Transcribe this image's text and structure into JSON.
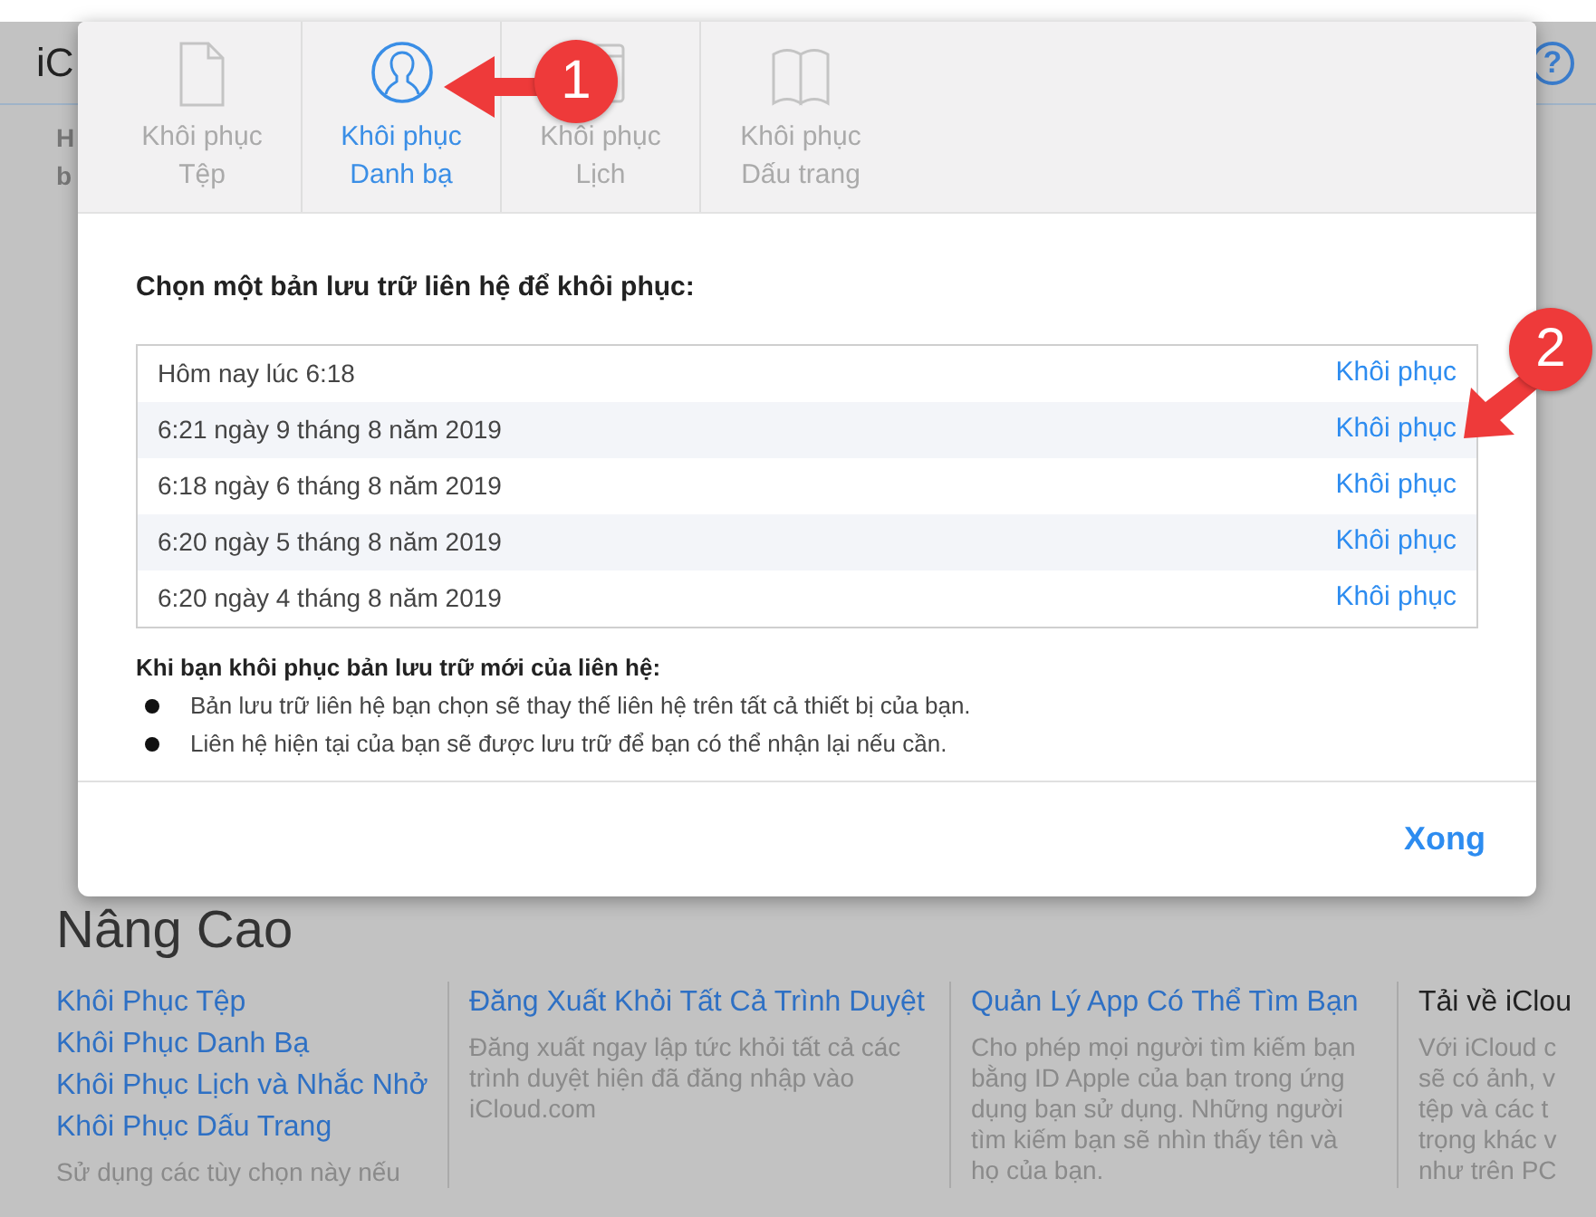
{
  "page": {
    "title": "iC",
    "help": "?",
    "left_text": [
      "H",
      "b"
    ]
  },
  "advanced": {
    "heading": "Nâng Cao",
    "columns": [
      {
        "links": [
          "Khôi Phục Tệp",
          "Khôi Phục Danh Bạ",
          "Khôi Phục Lịch và Nhắc Nhở",
          "Khôi Phục Dấu Trang"
        ],
        "description": [
          "Sử dụng các tùy chọn này nếu"
        ],
        "kind": "links"
      },
      {
        "links": [
          "Đăng Xuất Khỏi Tất Cả Trình Duyệt"
        ],
        "description": [
          "Đăng xuất ngay lập tức khỏi tất cả các",
          "trình duyệt hiện đã đăng nhập vào",
          "iCloud.com"
        ],
        "kind": "links"
      },
      {
        "links": [
          "Quản Lý App Có Thể Tìm Bạn"
        ],
        "description": [
          "Cho phép mọi người tìm kiếm bạn",
          "bằng ID Apple của bạn trong ứng",
          "dụng bạn sử dụng. Những người",
          "tìm kiếm bạn sẽ nhìn thấy tên và",
          "họ của bạn."
        ],
        "kind": "links"
      },
      {
        "title": "Tải về iClou",
        "description": [
          "Với iCloud c",
          "sẽ có ảnh, v",
          "tệp và các t",
          "trọng khác v",
          "như trên PC"
        ],
        "kind": "plain"
      }
    ]
  },
  "dialog": {
    "tabs": [
      {
        "lines": [
          "Khôi phục",
          "Tệp"
        ],
        "selected": false
      },
      {
        "lines": [
          "Khôi phục",
          "Danh bạ"
        ],
        "selected": true
      },
      {
        "lines": [
          "Khôi phục",
          "Lịch"
        ],
        "selected": false
      },
      {
        "lines": [
          "Khôi phục",
          "Dấu trang"
        ],
        "selected": false
      }
    ],
    "prompt": "Chọn một bản lưu trữ liên hệ để khôi phục:",
    "backups": [
      {
        "date": "Hôm nay lúc 6:18",
        "action": "Khôi phục"
      },
      {
        "date": "6:21 ngày 9 tháng 8 năm 2019",
        "action": "Khôi phục"
      },
      {
        "date": "6:18 ngày 6 tháng 8 năm 2019",
        "action": "Khôi phục"
      },
      {
        "date": "6:20 ngày 5 tháng 8 năm 2019",
        "action": "Khôi phục"
      },
      {
        "date": "6:20 ngày 4 tháng 8 năm 2019",
        "action": "Khôi phục"
      }
    ],
    "notes_title": "Khi bạn khôi phục bản lưu trữ mới của liên hệ:",
    "notes": [
      "Bản lưu trữ liên hệ bạn chọn sẽ thay thế liên hệ trên tất cả thiết bị của bạn.",
      "Liên hệ hiện tại của bạn sẽ được lưu trữ để bạn có thể nhận lại nếu cần."
    ],
    "done": "Xong"
  },
  "annotations": [
    {
      "label": "1",
      "kind": "left"
    },
    {
      "label": "2",
      "kind": "down-left"
    }
  ]
}
